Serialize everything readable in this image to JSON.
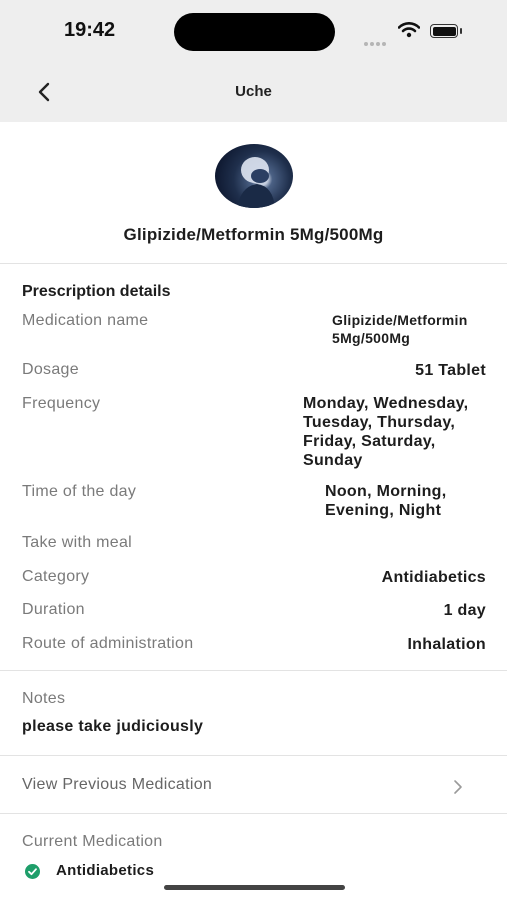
{
  "status": {
    "time": "19:42"
  },
  "nav": {
    "title": "Uche"
  },
  "header": {
    "title": "Glipizide/Metformin 5Mg/500Mg"
  },
  "prescription": {
    "section_title": "Prescription details",
    "rows": [
      {
        "label": "Medication name",
        "value": "Glipizide/Metformin\n5Mg/500Mg"
      },
      {
        "label": "Dosage",
        "value": "51 Tablet"
      },
      {
        "label": "Frequency",
        "value": "Monday, Wednesday,\nTuesday, Thursday,\nFriday, Saturday,\nSunday"
      },
      {
        "label": "Time of the day",
        "value": "Noon, Morning,\nEvening, Night"
      },
      {
        "label": "Take with meal",
        "value": ""
      },
      {
        "label": "Category",
        "value": "Antidiabetics"
      },
      {
        "label": "Duration",
        "value": "1 day"
      },
      {
        "label": "Route of administration",
        "value": "Inhalation"
      }
    ]
  },
  "notes": {
    "label": "Notes",
    "text": "please take judiciously"
  },
  "previous": {
    "label": "View Previous Medication"
  },
  "current": {
    "label": "Current Medication",
    "items": [
      "Antidiabetics"
    ]
  },
  "colors": {
    "accent_green": "#1e9e6a",
    "header_bg": "#eeeeee"
  }
}
